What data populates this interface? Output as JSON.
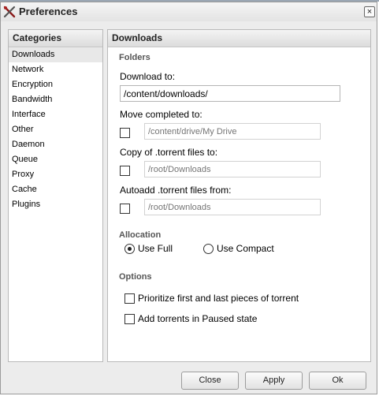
{
  "window": {
    "title": "Preferences",
    "app_icon": "tools-icon",
    "close_icon": "close-icon",
    "close_glyph": "×"
  },
  "categories": {
    "header": "Categories",
    "items": [
      {
        "label": "Downloads",
        "selected": true
      },
      {
        "label": "Network"
      },
      {
        "label": "Encryption"
      },
      {
        "label": "Bandwidth"
      },
      {
        "label": "Interface"
      },
      {
        "label": "Other"
      },
      {
        "label": "Daemon"
      },
      {
        "label": "Queue"
      },
      {
        "label": "Proxy"
      },
      {
        "label": "Cache"
      },
      {
        "label": "Plugins"
      }
    ]
  },
  "downloads": {
    "header": "Downloads",
    "folders": {
      "title": "Folders",
      "download_to": {
        "label": "Download to:",
        "value": "/content/downloads/"
      },
      "move_completed": {
        "label": "Move completed to:",
        "checked": false,
        "placeholder": "/content/drive/My Drive"
      },
      "copy_torrent": {
        "label": "Copy of .torrent files to:",
        "checked": false,
        "placeholder": "/root/Downloads"
      },
      "autoadd": {
        "label": "Autoadd .torrent files from:",
        "checked": false,
        "placeholder": "/root/Downloads"
      }
    },
    "allocation": {
      "title": "Allocation",
      "use_full": {
        "label": "Use Full",
        "checked": true
      },
      "use_compact": {
        "label": "Use Compact",
        "checked": false
      }
    },
    "options": {
      "title": "Options",
      "prioritize": {
        "label": "Prioritize first and last pieces of torrent",
        "checked": false
      },
      "add_paused": {
        "label": "Add torrents in Paused state",
        "checked": false
      }
    }
  },
  "buttons": {
    "close": "Close",
    "apply": "Apply",
    "ok": "Ok"
  },
  "colors": {
    "window_bg": "#ececec",
    "panel_bg": "#ffffff",
    "selected_row": "#e8e8e8",
    "section_title": "#555555",
    "disabled_text": "#a8a8a8"
  }
}
